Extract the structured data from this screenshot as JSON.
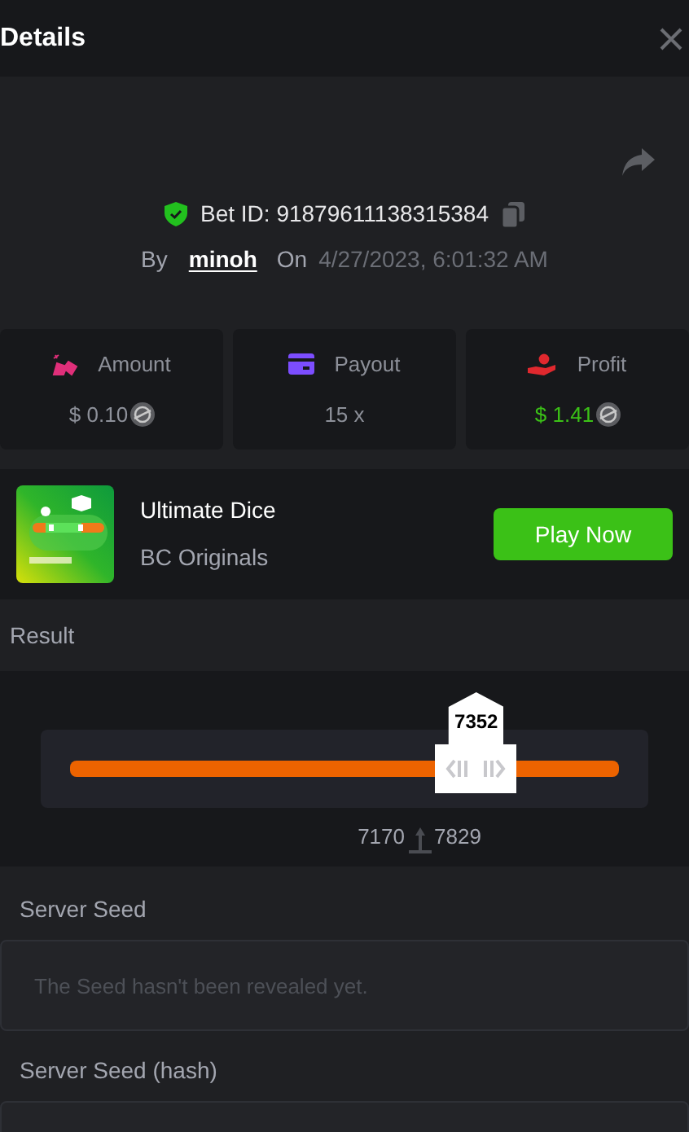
{
  "window": {
    "title": "Details"
  },
  "bet": {
    "verified": true,
    "id_label": "Bet ID: 91879611138315384",
    "by_label": "By",
    "user": "minoh",
    "on_label": "On",
    "date": "4/27/2023, 6:01:32 AM"
  },
  "stats": [
    {
      "kind": "amount",
      "label": "Amount",
      "value": "$ 0.10",
      "coin": true,
      "color": "#e02f7a"
    },
    {
      "kind": "payout",
      "label": "Payout",
      "value": "15 x",
      "coin": false,
      "color": "#7c4dff"
    },
    {
      "kind": "profit",
      "label": "Profit",
      "value": "$ 1.41",
      "coin": true,
      "color": "#e0282e"
    }
  ],
  "game": {
    "name": "Ultimate Dice",
    "provider": "BC Originals",
    "button": "Play Now"
  },
  "result": {
    "label": "Result",
    "value": "7352",
    "level": 0.74,
    "range_low": "7170",
    "range_high": "7829"
  },
  "seeds": [
    {
      "label": "Server Seed",
      "placeholder": "The Seed hasn't been revealed yet."
    },
    {
      "label": "Server Seed (hash)"
    }
  ]
}
